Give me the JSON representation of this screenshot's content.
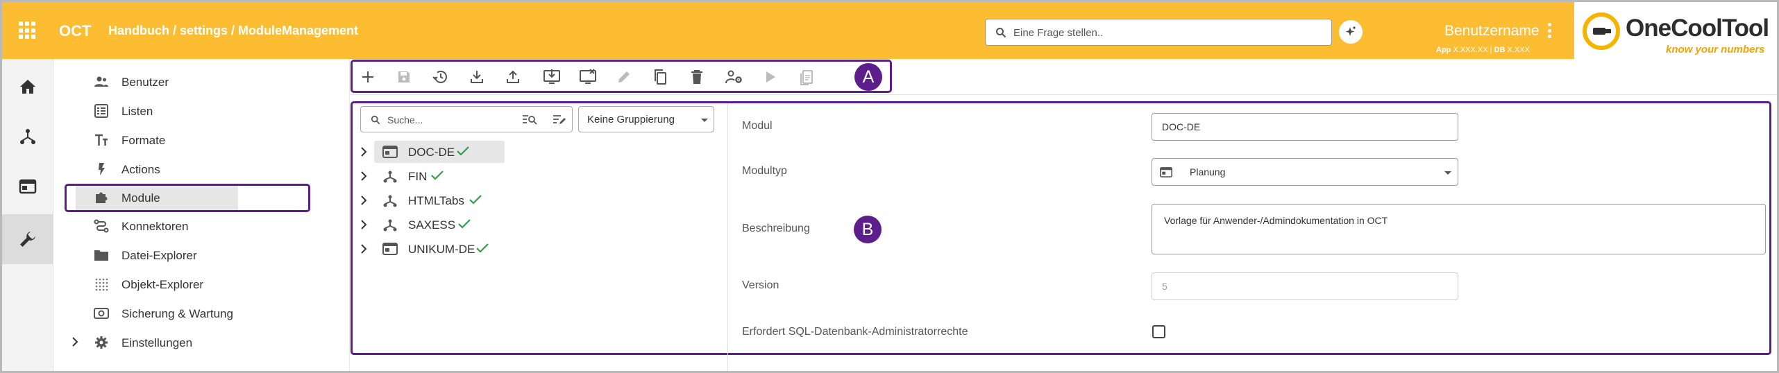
{
  "header": {
    "app_title": "OCT",
    "breadcrumb": "Handbuch / settings / ModuleManagement",
    "search_placeholder": "Eine Frage stellen..",
    "username": "Benutzername",
    "app_label": "App",
    "app_version": "X.XXX.XX",
    "db_label": "DB",
    "db_version": "X.XXX",
    "logo_name": "OneCoolTool",
    "logo_tagline": "know your numbers",
    "accent_color": "#fdbd32"
  },
  "rail": {
    "items": [
      {
        "icon": "home-icon"
      },
      {
        "icon": "hierarchy-icon"
      },
      {
        "icon": "window-icon"
      },
      {
        "icon": "wrench-icon"
      }
    ],
    "active_index": 3
  },
  "sidebar": {
    "items": [
      {
        "label": "Benutzer",
        "icon": "users-icon"
      },
      {
        "label": "Listen",
        "icon": "list-icon"
      },
      {
        "label": "Formate",
        "icon": "format-icon"
      },
      {
        "label": "Actions",
        "icon": "lightning-icon"
      },
      {
        "label": "Module",
        "icon": "puzzle-icon"
      },
      {
        "label": "Konnektoren",
        "icon": "connector-icon"
      },
      {
        "label": "Datei-Explorer",
        "icon": "folder-icon"
      },
      {
        "label": "Objekt-Explorer",
        "icon": "object-grid-icon"
      },
      {
        "label": "Sicherung & Wartung",
        "icon": "backup-icon"
      },
      {
        "label": "Einstellungen",
        "icon": "gear-icon"
      }
    ],
    "active_index": 4
  },
  "toolbar": {
    "buttons": [
      {
        "name": "add",
        "icon": "plus-icon",
        "enabled": true
      },
      {
        "name": "save",
        "icon": "save-icon",
        "enabled": false
      },
      {
        "name": "reload",
        "icon": "history-icon",
        "enabled": true
      },
      {
        "name": "download",
        "icon": "download-icon",
        "enabled": true
      },
      {
        "name": "upload",
        "icon": "upload-icon",
        "enabled": true
      },
      {
        "name": "install",
        "icon": "monitor-download-icon",
        "enabled": true
      },
      {
        "name": "uninstall",
        "icon": "monitor-remove-icon",
        "enabled": true
      },
      {
        "name": "edit",
        "icon": "pencil-icon",
        "enabled": false
      },
      {
        "name": "copy",
        "icon": "copy-icon",
        "enabled": true
      },
      {
        "name": "delete",
        "icon": "trash-icon",
        "enabled": true
      },
      {
        "name": "user-settings",
        "icon": "user-gear-icon",
        "enabled": true
      },
      {
        "name": "run",
        "icon": "play-icon",
        "enabled": false
      },
      {
        "name": "clipboard",
        "icon": "clipboard-icon",
        "enabled": false
      }
    ]
  },
  "annotations": {
    "a": "A",
    "b": "B",
    "color": "#5b1e8a"
  },
  "tree": {
    "search_placeholder": "Suche...",
    "grouping": "Keine Gruppierung",
    "items": [
      {
        "label": "DOC-DE",
        "icon": "window-icon",
        "status": "check-icon"
      },
      {
        "label": "FIN",
        "icon": "hierarchy-icon",
        "status": "check-icon"
      },
      {
        "label": "HTMLTabs",
        "icon": "hierarchy-icon",
        "status": "check-icon"
      },
      {
        "label": "SAXESS",
        "icon": "hierarchy-icon",
        "status": "check-icon"
      },
      {
        "label": "UNIKUM-DE",
        "icon": "window-icon",
        "status": "check-icon"
      }
    ],
    "selected_index": 0,
    "check_color": "#2e9e4a"
  },
  "form": {
    "modul_label": "Modul",
    "modul_value": "DOC-DE",
    "modultyp_label": "Modultyp",
    "modultyp_value": "Planung",
    "beschreibung_label": "Beschreibung",
    "beschreibung_value": "Vorlage für Anwender-/Admindokumentation in OCT",
    "version_label": "Version",
    "version_value": "5",
    "sql_label": "Erfordert SQL-Datenbank-Administratorrechte",
    "sql_checked": false
  }
}
